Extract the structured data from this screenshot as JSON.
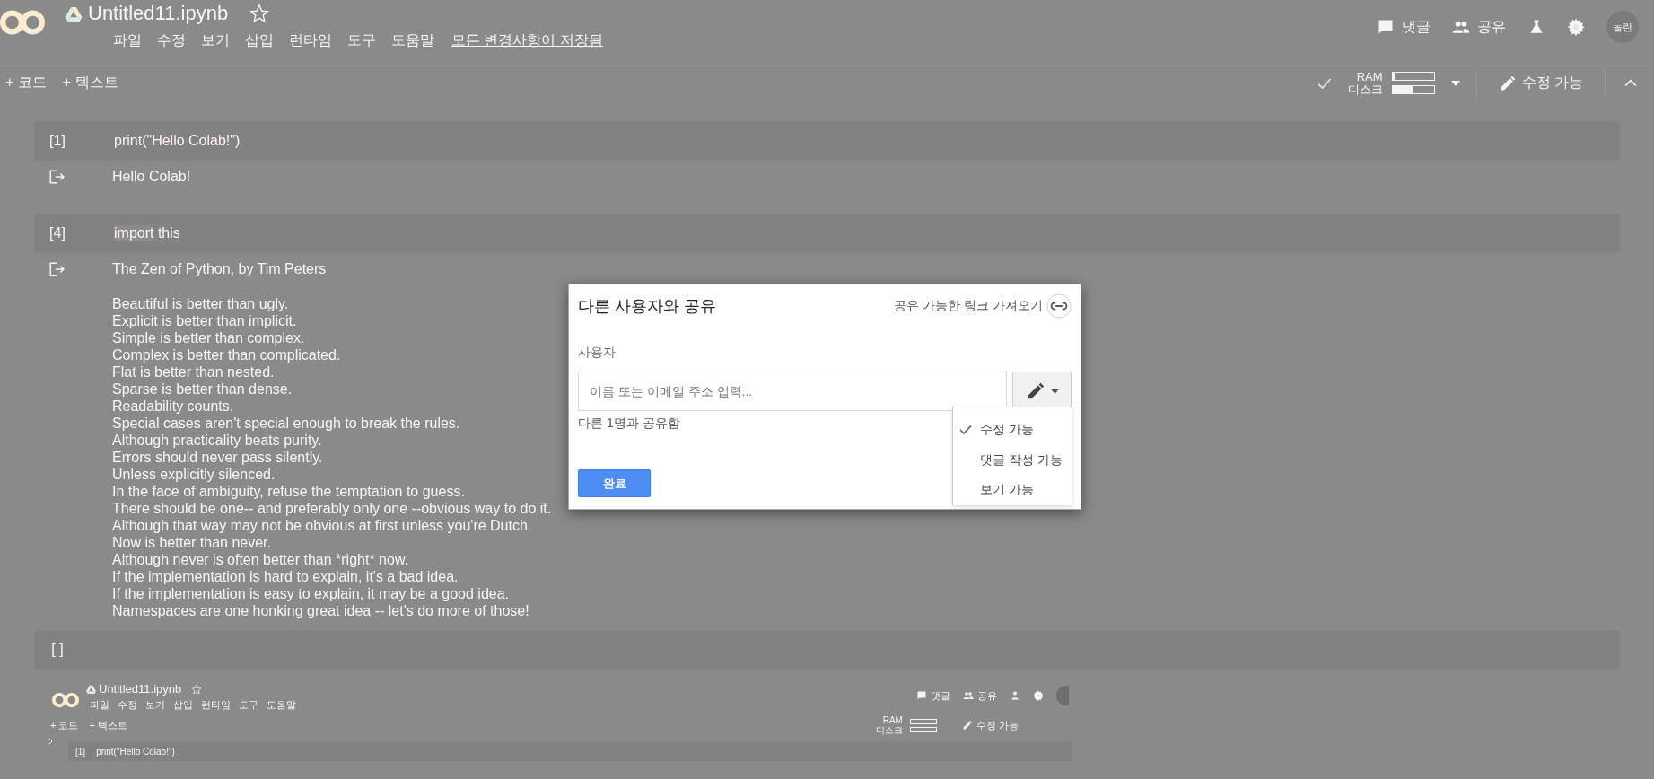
{
  "header": {
    "title": "Untitled11.ipynb",
    "menu": [
      "파일",
      "수정",
      "보기",
      "삽입",
      "런타임",
      "도구",
      "도움말"
    ],
    "save_status": "모든 변경사항이 저장됨",
    "actions": [
      {
        "kind": "comment",
        "label": "댓글"
      },
      {
        "kind": "share",
        "label": "공유"
      }
    ],
    "avatar_text": "놀란"
  },
  "toolbar": {
    "add_buttons": [
      "+ 코드",
      "+ 텍스트"
    ],
    "ram_label": "RAM",
    "ram": {
      "level": 0.06
    },
    "disk_label": "디스크",
    "disk": {
      "level": 0.5
    },
    "edit_mode": "수정 가능"
  },
  "cells": [
    {
      "kind": "code",
      "prompt": "[1]",
      "code": [
        {
          "kind": "plain",
          "text": "print("
        },
        {
          "kind": "string",
          "text": "\"Hello Colab!\""
        },
        {
          "kind": "plain",
          "text": ")"
        }
      ],
      "output": [
        "Hello Colab!"
      ]
    },
    {
      "kind": "code",
      "prompt": "[4]",
      "code": [
        {
          "kind": "keyword",
          "text": "import"
        },
        {
          "kind": "plain",
          "text": " this"
        }
      ],
      "output": [
        "The Zen of Python, by Tim Peters",
        "Beautiful is better than ugly.",
        "Explicit is better than implicit.",
        "Simple is better than complex.",
        "Complex is better than complicated.",
        "Flat is better than nested.",
        "Sparse is better than dense.",
        "Readability counts.",
        "Special cases aren't special enough to break the rules.",
        "Although practicality beats purity.",
        "Errors should never pass silently.",
        "Unless explicitly silenced.",
        "In the face of ambiguity, refuse the temptation to guess.",
        "There should be one-- and preferably only one --obvious way to do it.",
        "Although that way may not be obvious at first unless you're Dutch.",
        "Now is better than never.",
        "Although never is often better than *right* now.",
        "If the implementation is hard to explain, it's a bad idea.",
        "If the implementation is easy to explain, it may be a good idea.",
        "Namespaces are one honking great idea -- let's do more of those!"
      ]
    },
    {
      "kind": "code",
      "prompt": "[ ]"
    }
  ],
  "embedded_screenshot": {
    "title": "Untitled11.ipynb",
    "menu": [
      "파일",
      "수정",
      "보기",
      "삽입",
      "런타임",
      "도구",
      "도움말"
    ],
    "add_buttons": [
      "+ 코드",
      "+ 텍스트"
    ],
    "actions": [
      {
        "kind": "comment",
        "label": "댓글"
      },
      {
        "kind": "share",
        "label": "공유"
      }
    ],
    "ram_label": "RAM",
    "disk_label": "디스크",
    "edit_mode": "수정 가능",
    "cell_prompt": "[1]",
    "code": [
      {
        "kind": "plain",
        "text": "print("
      },
      {
        "kind": "string",
        "text": "\"Hello Colab!\""
      },
      {
        "kind": "plain",
        "text": ")"
      }
    ]
  },
  "dialog": {
    "title": "다른 사용자와 공유",
    "link_label": "공유 가능한 링크 가져오기",
    "users_label": "사용자",
    "input": {
      "placeholder": "이름 또는 이메일 주소 입력..."
    },
    "shared_with": "다른 1명과 공유함",
    "done_button": "완료",
    "permissions": [
      {
        "label": "수정 가능",
        "selected": true
      },
      {
        "label": "댓글 작성 가능",
        "selected": false
      },
      {
        "label": "보기 가능",
        "selected": false
      }
    ]
  }
}
